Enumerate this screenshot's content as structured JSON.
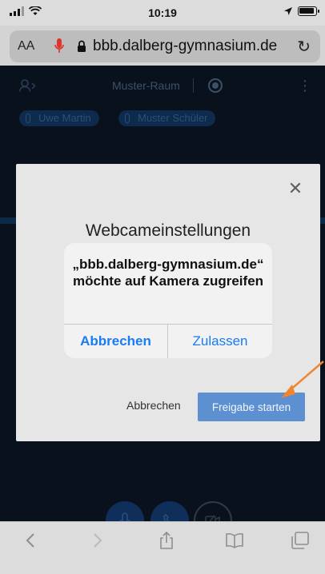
{
  "status_bar": {
    "time": "10:19"
  },
  "safari": {
    "text_size_label": "AA",
    "url": "bbb.dalberg-gymnasium.de"
  },
  "conference": {
    "room_title": "Muster-Raum",
    "participants": [
      "Uwe Martin",
      "Muster Schüler"
    ]
  },
  "modal": {
    "title": "Webcameinstellungen",
    "cancel_label": "Abbrechen",
    "start_share_label": "Freigabe starten"
  },
  "alert": {
    "message": "„bbb.dalberg-gymnasium.de“ möchte auf Kamera zugreifen",
    "deny_label": "Abbrechen",
    "allow_label": "Zulassen",
    "accent_color": "#1a7bf2"
  },
  "colors": {
    "share_button": "#5d90d0",
    "annotation_arrow": "#ee8631"
  },
  "icons": {
    "status": [
      "signal-icon",
      "wifi-icon",
      "location-icon",
      "battery-icon"
    ],
    "toolbar": [
      "back-icon",
      "forward-icon",
      "share-icon",
      "bookmarks-icon",
      "tabs-icon"
    ]
  }
}
